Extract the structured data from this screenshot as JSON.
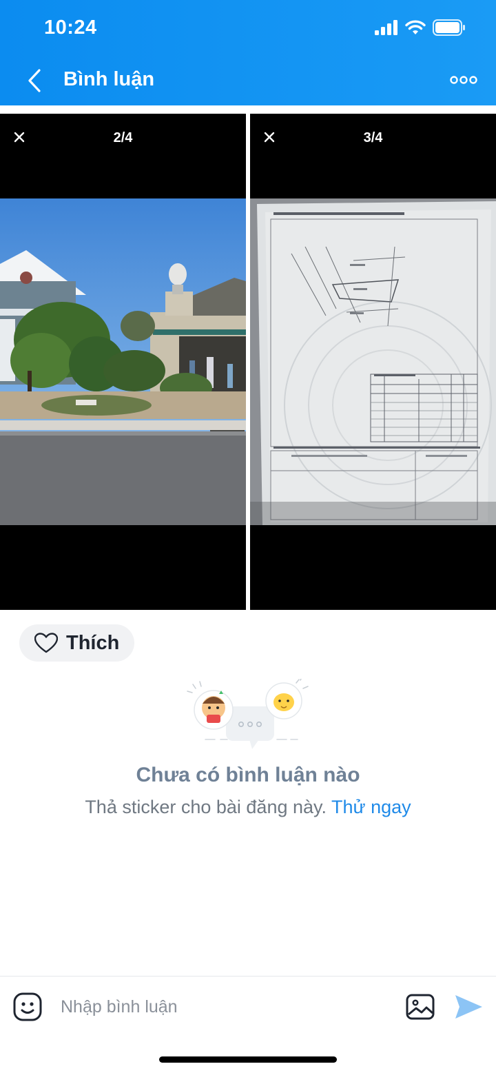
{
  "status_bar": {
    "time": "10:24"
  },
  "header": {
    "title": "Bình luận"
  },
  "media": [
    {
      "counter": "2/4",
      "description": "street photo"
    },
    {
      "counter": "3/4",
      "description": "land document"
    }
  ],
  "like": {
    "label": "Thích"
  },
  "empty_state": {
    "title": "Chưa có bình luận nào",
    "subtitle": "Thả sticker cho bài đăng này.",
    "link": "Thử ngay"
  },
  "composer": {
    "placeholder": "Nhập bình luận"
  },
  "colors": {
    "header_blue": "#0b8cf0",
    "link_blue": "#1f8ae8",
    "send_blue": "#8cc4f5"
  },
  "icons": [
    "back-arrow-icon",
    "more-icon",
    "close-icon",
    "heart-icon",
    "sticker-icon",
    "image-icon",
    "send-icon",
    "signal-icon",
    "wifi-icon",
    "battery-icon"
  ]
}
